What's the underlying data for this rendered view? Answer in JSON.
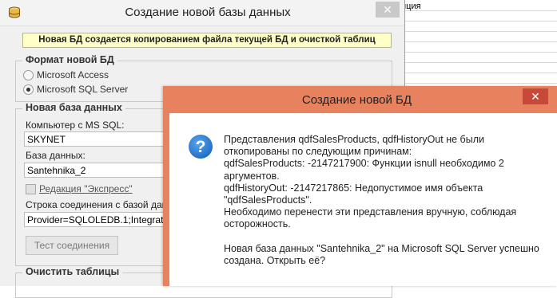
{
  "background_sheet": {
    "cell_text": "иция"
  },
  "main_dialog": {
    "title": "Создание новой базы данных",
    "close_glyph": "✕",
    "info_banner": "Новая БД создается копированием файла текущей БД и очисткой таблиц",
    "format_group": {
      "title": "Формат новой БД",
      "options": [
        {
          "label": "Microsoft Access",
          "selected": false
        },
        {
          "label": "Microsoft SQL Server",
          "selected": true
        }
      ]
    },
    "newdb_group": {
      "title": "Новая база данных",
      "computer_label": "Компьютер с MS SQL:",
      "computer_value": "SKYNET",
      "database_label": "База данных:",
      "database_value": "Santehnika_2",
      "express_label": "Редакция \"Экспресс\"",
      "express_checked": false,
      "connection_label": "Строка соединения с базой данных",
      "connection_value": "Provider=SQLOLEDB.1;Integrated S",
      "test_button": "Тест соединения"
    },
    "clear_group": {
      "title": "Очистить таблицы"
    }
  },
  "message_box": {
    "title": "Создание новой БД",
    "close_glyph": "✕",
    "icon": "question-icon",
    "paragraphs": [
      [
        "Представления qdfSalesProducts, qdfHistoryOut не были",
        "откопированы по следующим причинам:",
        "qdfSalesProducts: -2147217900: Функции isnull необходимо 2",
        "аргументов.",
        "qdfHistoryOut: -2147217865: Недопустимое имя объекта",
        "\"qdfSalesProducts\".",
        "Необходимо перенести эти представления вручную, соблюдая",
        "осторожность."
      ],
      [
        "Новая база данных \"Santehnika_2\" на Microsoft SQL Server успешно",
        "создана. Открыть её?"
      ]
    ]
  },
  "colors": {
    "message_frame": "#e8825e",
    "message_close": "#c7493a",
    "banner_background": "#ffffc8",
    "question_icon": "#1f6fc6"
  }
}
